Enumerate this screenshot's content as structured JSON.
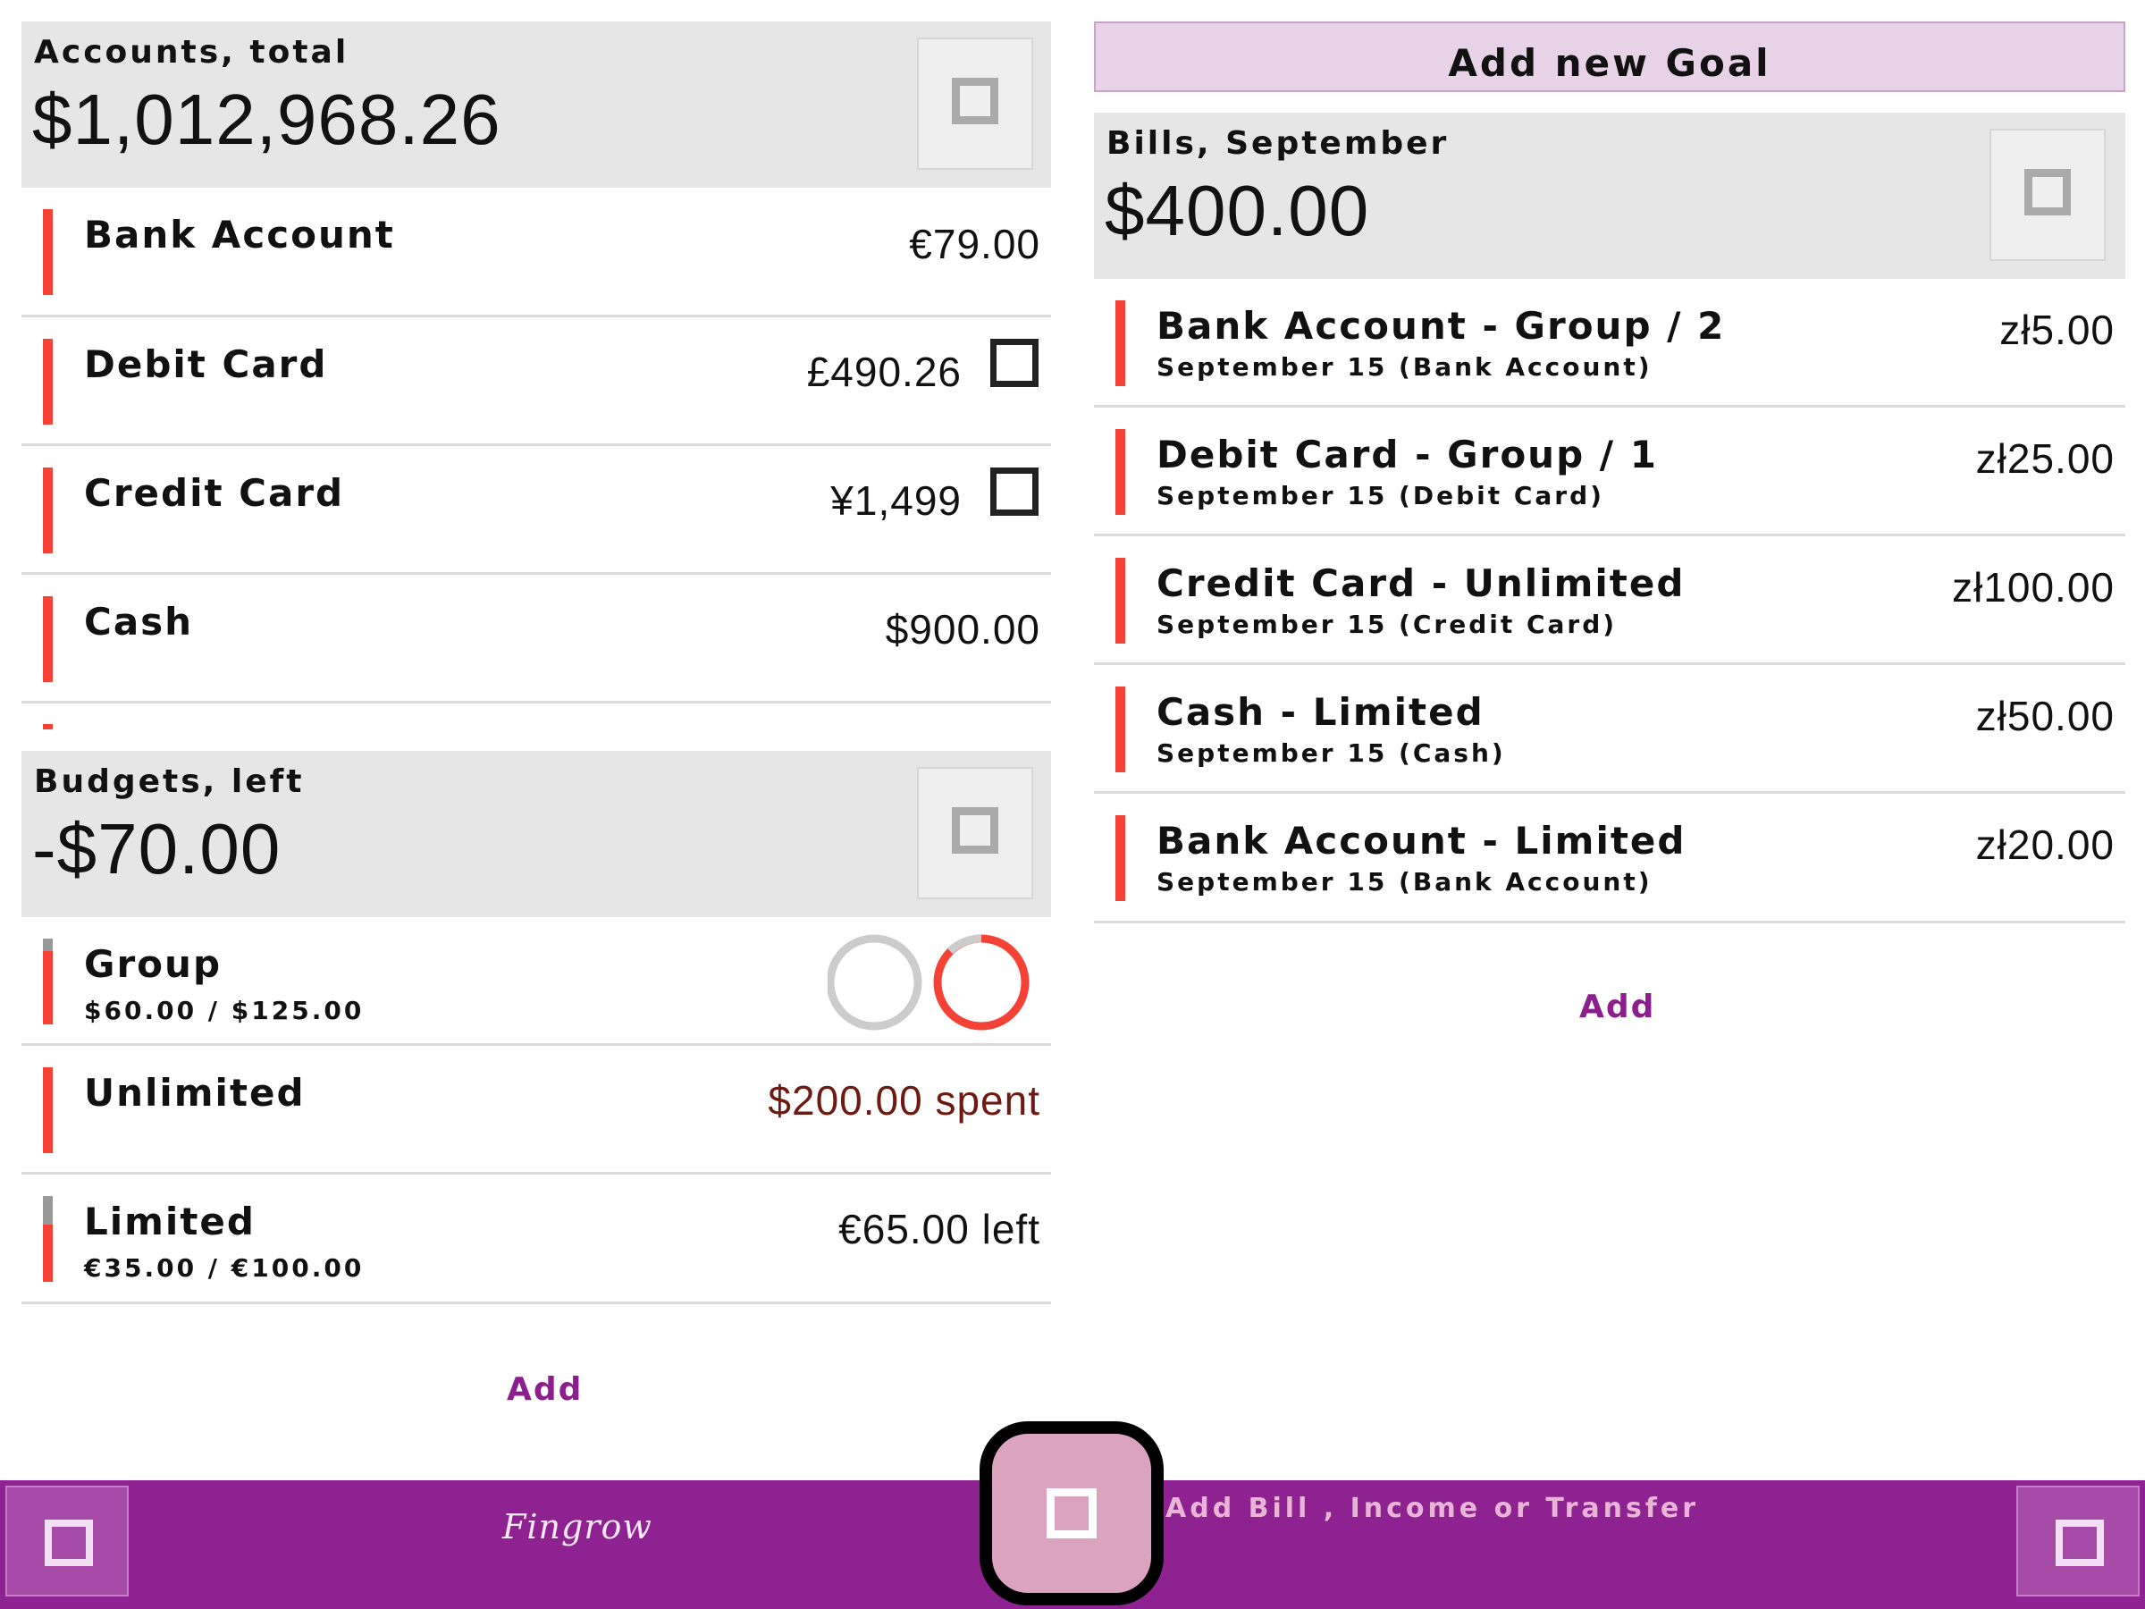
{
  "accounts": {
    "label": "Accounts, total",
    "total": "$1,012,968.26",
    "items": [
      {
        "name": "Bank Account",
        "amount": "€79.00"
      },
      {
        "name": "Debit Card",
        "amount": "£490.26"
      },
      {
        "name": "Credit Card",
        "amount": "¥1,499"
      },
      {
        "name": "Cash",
        "amount": "$900.00"
      }
    ]
  },
  "budgets": {
    "label": "Budgets, left",
    "total": "-$70.00",
    "items": [
      {
        "name": "Group",
        "sub": "$60.00 / $125.00"
      },
      {
        "name": "Unlimited",
        "amount": "$200.00 spent"
      },
      {
        "name": "Limited",
        "sub": "€35.00 / €100.00",
        "amount": "€65.00 left"
      }
    ],
    "add_label": "Add"
  },
  "goal": {
    "add_label": "Add new Goal"
  },
  "bills": {
    "label": "Bills, September",
    "total": "$400.00",
    "items": [
      {
        "name": "Bank Account - Group / 2",
        "sub": "September 15 (Bank Account)",
        "amount": "zł5.00"
      },
      {
        "name": "Debit Card - Group / 1",
        "sub": "September 15 (Debit Card)",
        "amount": "zł25.00"
      },
      {
        "name": "Credit Card - Unlimited",
        "sub": "September 15 (Credit Card)",
        "amount": "zł100.00"
      },
      {
        "name": "Cash - Limited",
        "sub": "September 15 (Cash)",
        "amount": "zł50.00"
      },
      {
        "name": "Bank Account - Limited",
        "sub": "September 15 (Bank Account)",
        "amount": "zł20.00"
      }
    ],
    "add_label": "Add"
  },
  "bottom_bar": {
    "logo": "Fingrow",
    "fab_label": "Add Bill , Income or Transfer"
  },
  "colors": {
    "accent": "#8e2291",
    "indicator": "#f44336",
    "card_bg": "#e6e6e6",
    "spent_text": "#6d1a12",
    "goal_bg": "#e8d2e8"
  },
  "icons": {
    "card_menu": "square-icon",
    "checkbox": "checkbox-icon",
    "fab": "square-icon"
  }
}
